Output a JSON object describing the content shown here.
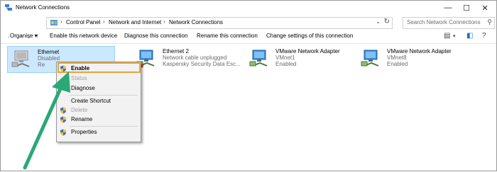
{
  "window": {
    "title": "Network Connections",
    "minimize_icon": "minimize-icon",
    "maximize_icon": "maximize-icon",
    "close_icon": "close-icon"
  },
  "addressbar": {
    "breadcrumbs": [
      "Control Panel",
      "Network and Internet",
      "Network Connections"
    ],
    "search_placeholder": "Search Network Connections"
  },
  "toolbar": {
    "organise_label": "Organise ▾",
    "enable_label": "Enable this network device",
    "diagnose_label": "Diagnose this connection",
    "rename_label": "Rename this connection",
    "change_label": "Change settings of this connection"
  },
  "connections": [
    {
      "name": "Ethernet",
      "status": "Disabled",
      "device": "Re"
    },
    {
      "name": "Ethernet 2",
      "status": "Network cable unplugged",
      "device": "Kaspersky Security Data Esc..."
    },
    {
      "name": "VMware Network Adapter",
      "status": "VMnet1",
      "device": "Enabled"
    },
    {
      "name": "VMware Network Adapter",
      "status": "VMnet8",
      "device": "Enabled"
    }
  ],
  "context_menu": {
    "enable": "Enable",
    "status": "Status",
    "diagnose": "Diagnose",
    "create_shortcut": "Create Shortcut",
    "delete": "Delete",
    "rename": "Rename",
    "properties": "Properties"
  },
  "colors": {
    "highlight": "#e8a23a",
    "arrow": "#2aa876",
    "selection": "#cce8ff"
  }
}
